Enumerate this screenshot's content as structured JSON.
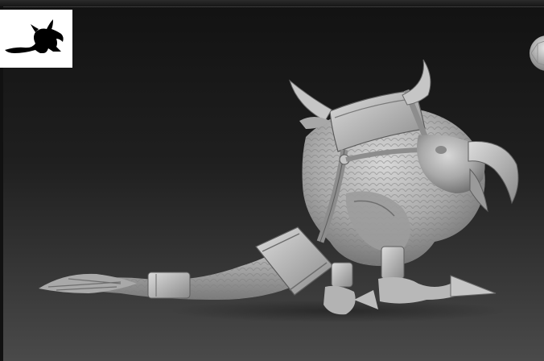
{
  "viewport": {
    "background_top": "#121212",
    "background_bottom": "#4a4a4a",
    "model_color": "#b9b9b9"
  },
  "thumbnail": {
    "background": "#ffffff",
    "silhouette_color": "#000000",
    "icon": "creature-silhouette-icon"
  },
  "navigation": {
    "icon": "navigation-sphere-icon"
  },
  "model": {
    "icon": "sculpted-creature-model"
  }
}
